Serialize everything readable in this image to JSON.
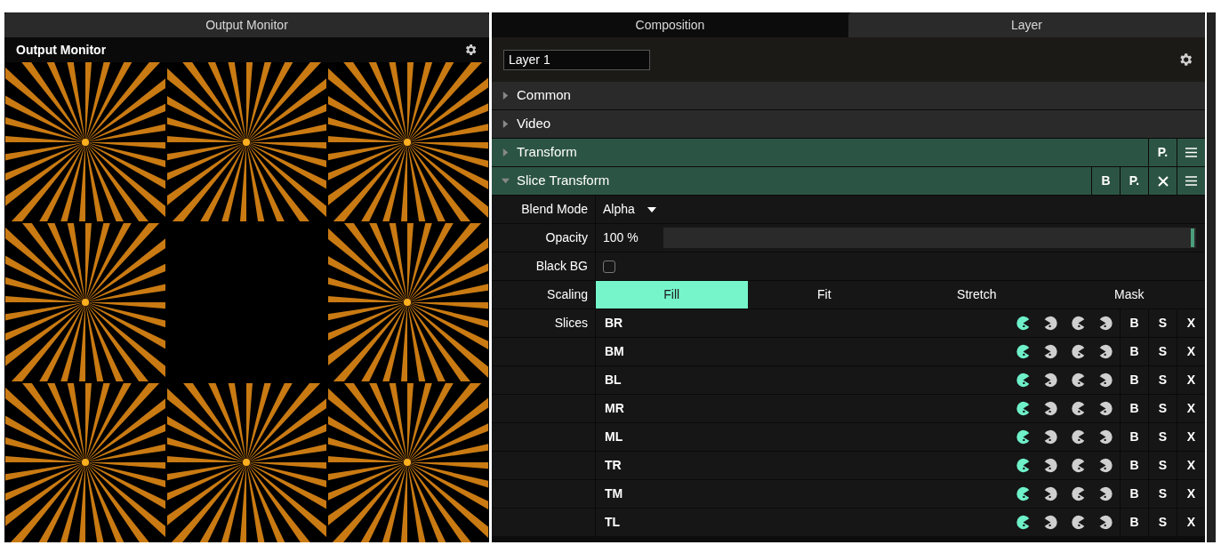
{
  "monitor_panel": {
    "tab": "Output Monitor",
    "title": "Output Monitor"
  },
  "tabs": [
    {
      "label": "Composition",
      "selected": false
    },
    {
      "label": "Layer",
      "selected": true
    }
  ],
  "layer_name": "Layer 1",
  "sections": [
    {
      "label": "Common",
      "expanded": false,
      "active": false
    },
    {
      "label": "Video",
      "expanded": false,
      "active": false
    },
    {
      "label": "Transform",
      "expanded": false,
      "active": true,
      "buttons": [
        "P."
      ]
    },
    {
      "label": "Slice Transform",
      "expanded": true,
      "active": true,
      "buttons": [
        "B",
        "P."
      ]
    }
  ],
  "blend_mode": {
    "label": "Blend Mode",
    "value": "Alpha"
  },
  "opacity": {
    "label": "Opacity",
    "reading": "100 %",
    "level": 1
  },
  "black_bg": {
    "label": "Black BG",
    "checked": false
  },
  "scaling": {
    "label": "Scaling",
    "options": [
      {
        "label": "Fill",
        "selected": true
      },
      {
        "label": "Fit",
        "selected": false
      },
      {
        "label": "Stretch",
        "selected": false
      },
      {
        "label": "Mask",
        "selected": false
      }
    ]
  },
  "slices": {
    "label": "Slices",
    "rows": [
      {
        "name": "BR",
        "modes": [
          {
            "selected": true
          },
          {
            "selected": false
          },
          {
            "selected": false
          },
          {
            "selected": false
          }
        ],
        "buttons": [
          "B",
          "S",
          "X"
        ]
      },
      {
        "name": "BM",
        "modes": [
          {
            "selected": true
          },
          {
            "selected": false
          },
          {
            "selected": false
          },
          {
            "selected": false
          }
        ],
        "buttons": [
          "B",
          "S",
          "X"
        ]
      },
      {
        "name": "BL",
        "modes": [
          {
            "selected": true
          },
          {
            "selected": false
          },
          {
            "selected": false
          },
          {
            "selected": false
          }
        ],
        "buttons": [
          "B",
          "S",
          "X"
        ]
      },
      {
        "name": "MR",
        "modes": [
          {
            "selected": true
          },
          {
            "selected": false
          },
          {
            "selected": false
          },
          {
            "selected": false
          }
        ],
        "buttons": [
          "B",
          "S",
          "X"
        ]
      },
      {
        "name": "ML",
        "modes": [
          {
            "selected": true
          },
          {
            "selected": false
          },
          {
            "selected": false
          },
          {
            "selected": false
          }
        ],
        "buttons": [
          "B",
          "S",
          "X"
        ]
      },
      {
        "name": "TR",
        "modes": [
          {
            "selected": true
          },
          {
            "selected": false
          },
          {
            "selected": false
          },
          {
            "selected": false
          }
        ],
        "buttons": [
          "B",
          "S",
          "X"
        ]
      },
      {
        "name": "TM",
        "modes": [
          {
            "selected": true
          },
          {
            "selected": false
          },
          {
            "selected": false
          },
          {
            "selected": false
          }
        ],
        "buttons": [
          "B",
          "S",
          "X"
        ]
      },
      {
        "name": "TL",
        "modes": [
          {
            "selected": true
          },
          {
            "selected": false
          },
          {
            "selected": false
          },
          {
            "selected": false
          }
        ],
        "buttons": [
          "B",
          "S",
          "X"
        ]
      }
    ]
  }
}
